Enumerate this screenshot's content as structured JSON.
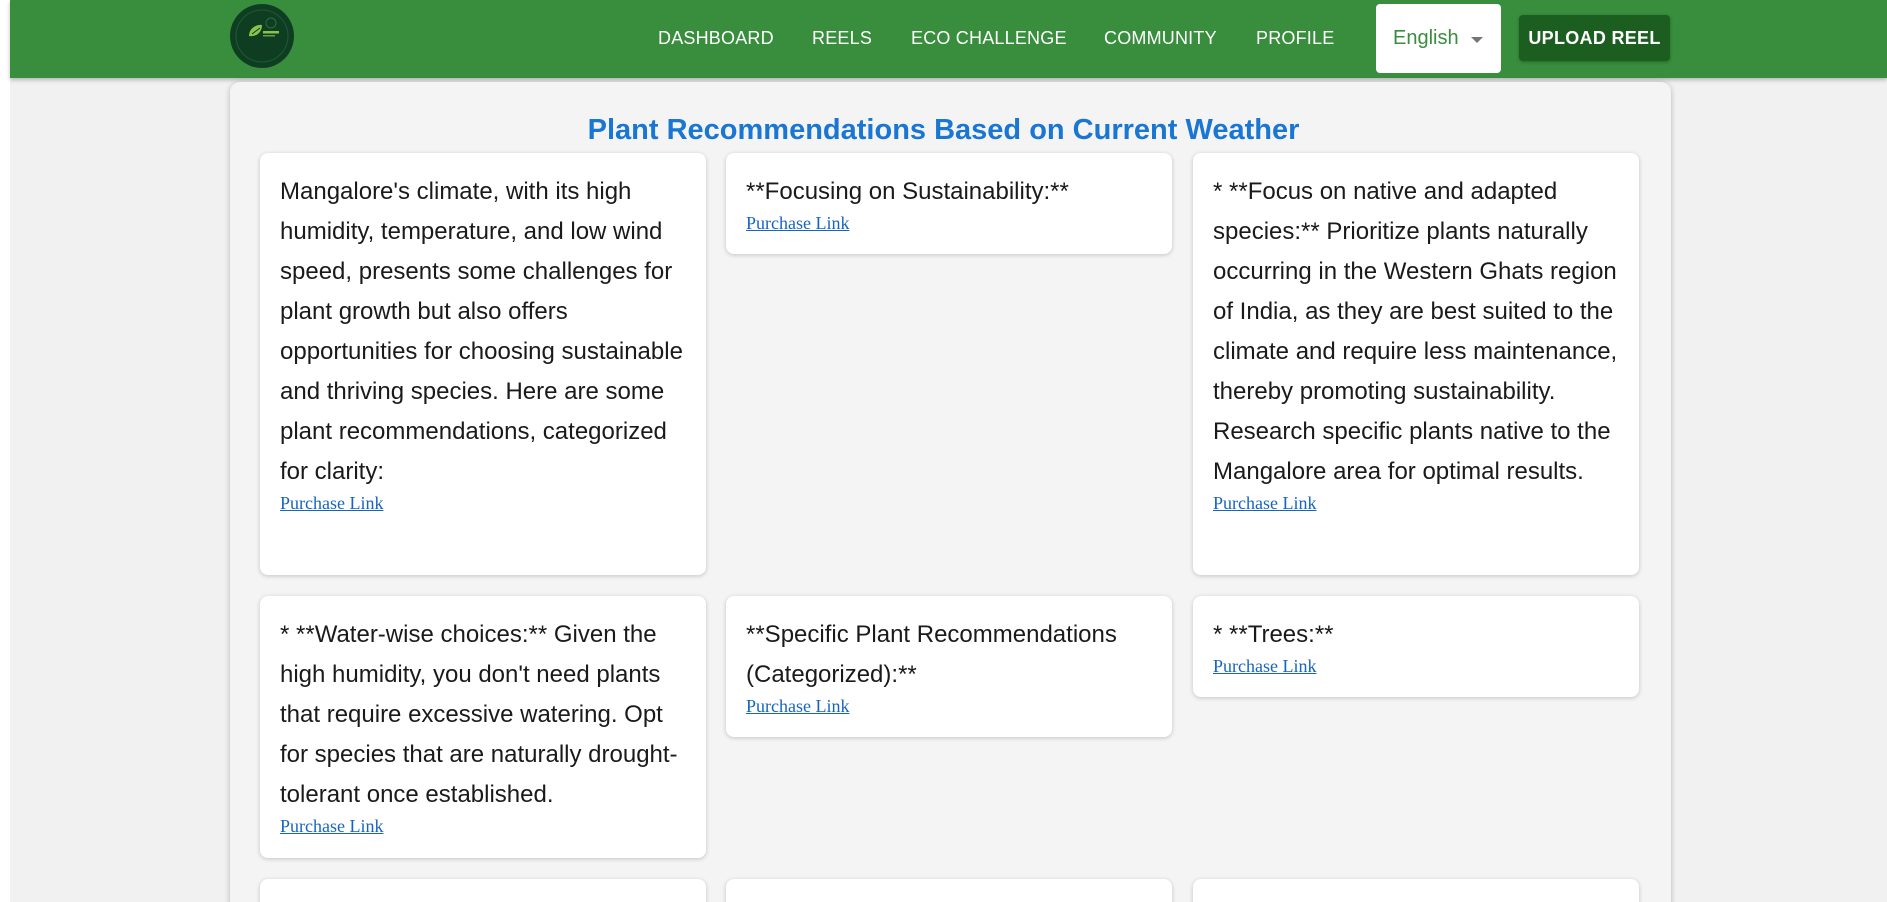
{
  "navbar": {
    "links": [
      "DASHBOARD",
      "REELS",
      "ECO CHALLENGE",
      "COMMUNITY",
      "PROFILE"
    ],
    "language": "English",
    "upload_label": "UPLOAD REEL"
  },
  "page": {
    "title": "Plant Recommendations Based on Current Weather"
  },
  "cards": [
    {
      "text": "Mangalore's climate, with its high humidity, temperature, and low wind speed, presents some challenges for plant growth but also offers opportunities for choosing sustainable and thriving species. Here are some plant recommendations, categorized for clarity:",
      "link": "Purchase Link"
    },
    {
      "text": "**Focusing on Sustainability:**",
      "link": "Purchase Link"
    },
    {
      "text": "* **Focus on native and adapted species:** Prioritize plants naturally occurring in the Western Ghats region of India, as they are best suited to the climate and require less maintenance, thereby promoting sustainability. Research specific plants native to the Mangalore area for optimal results.",
      "link": "Purchase Link"
    },
    {
      "text": "* **Water-wise choices:** Given the high humidity, you don't need plants that require excessive watering. Opt for species that are naturally drought-tolerant once established.",
      "link": "Purchase Link"
    },
    {
      "text": "**Specific Plant Recommendations (Categorized):**",
      "link": "Purchase Link"
    },
    {
      "text": "* **Trees:**",
      "link": "Purchase Link"
    }
  ],
  "colors": {
    "navbar": "#388e3c",
    "upload_button": "#1b5e20",
    "title": "#1976d2",
    "link": "#1565c0"
  }
}
